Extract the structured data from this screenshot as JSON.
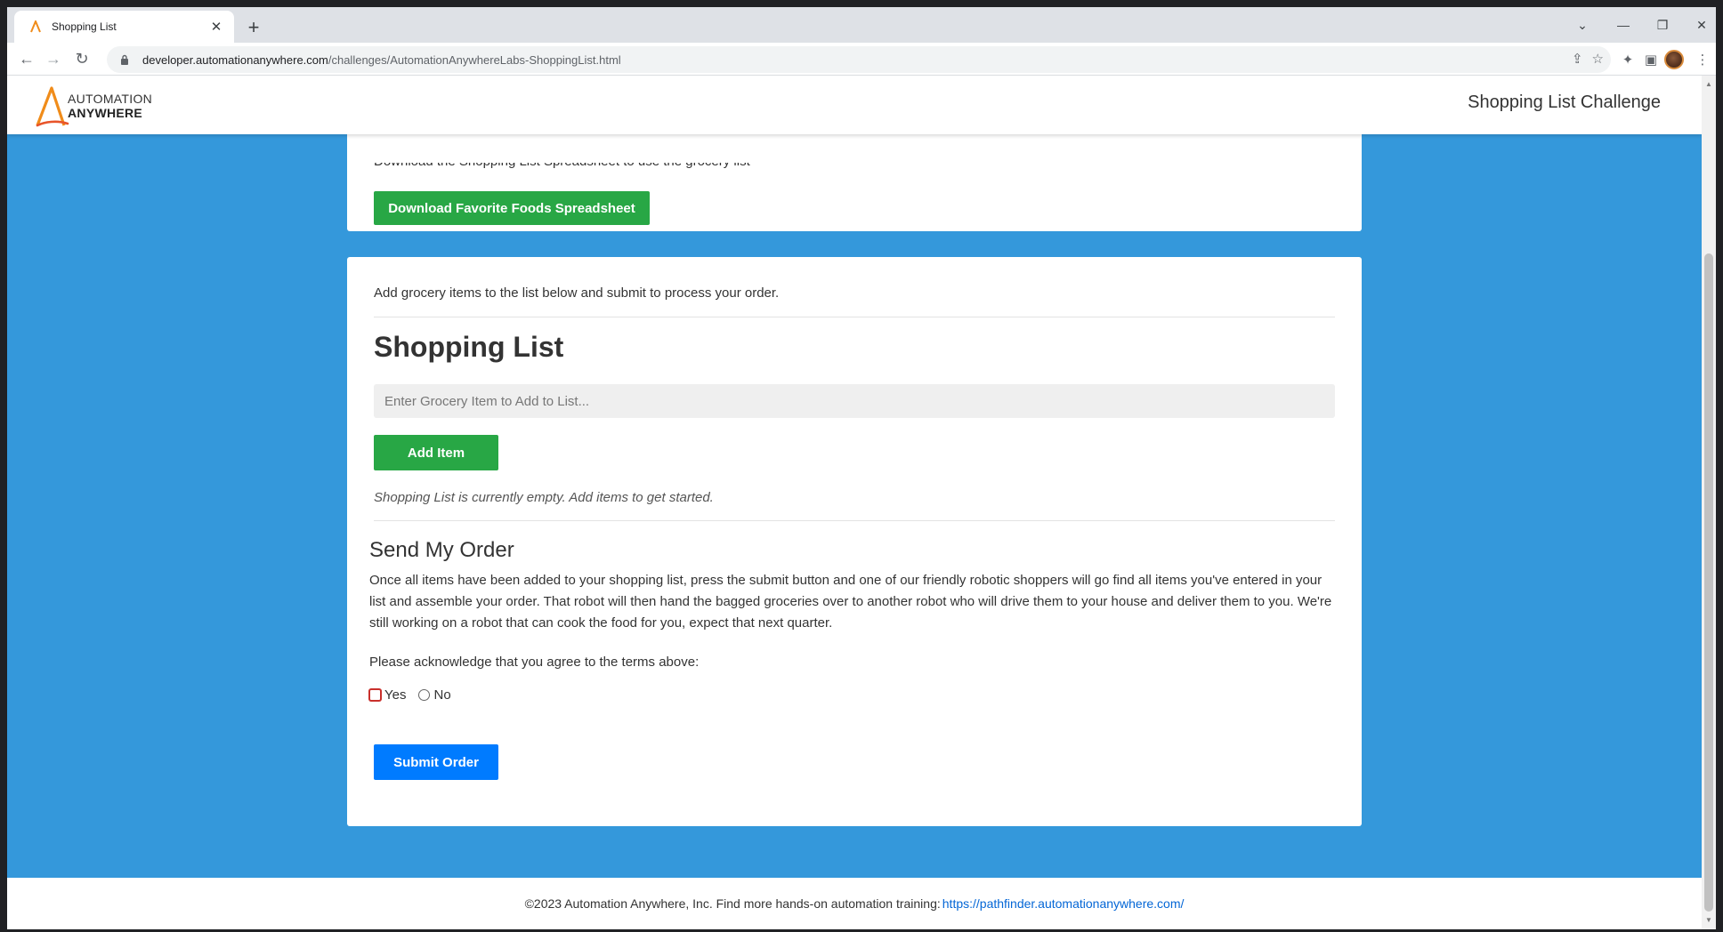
{
  "browser": {
    "tab_title": "Shopping List",
    "url_host": "developer.automationanywhere.com",
    "url_path": "/challenges/AutomationAnywhereLabs-ShoppingList.html",
    "icons": [
      "back-icon",
      "forward-icon",
      "reload-icon",
      "lock-icon",
      "share-icon",
      "star-icon",
      "extensions-icon",
      "side-panel-icon",
      "menu-icon"
    ]
  },
  "header": {
    "logo_line1": "AUTOMATION",
    "logo_line2": "ANYWHERE",
    "title": "Shopping List Challenge",
    "brand_color": "#f08c1a"
  },
  "top_card": {
    "cut_text": "Download the Shopping List Spreadsheet to use the grocery list",
    "download_label": "Download Favorite Foods Spreadsheet"
  },
  "main_card": {
    "intro": "Add grocery items to the list below and submit to process your order.",
    "heading": "Shopping List",
    "input_placeholder": "Enter Grocery Item to Add to List...",
    "add_label": "Add Item",
    "empty_message": "Shopping List is currently empty. Add items to get started.",
    "send_heading": "Send My Order",
    "paragraph": "Once all items have been added to your shopping list, press the submit button and one of our friendly robotic shoppers will go find all items you've entered in your list and assemble your order. That robot will then hand the bagged groceries over to another robot who will drive them to your house and deliver them to you. We're still working on a robot that can cook the food for you, expect that next quarter.",
    "acknowledge": "Please acknowledge that you agree to the terms above:",
    "yes_label": "Yes",
    "no_label": "No",
    "submit_label": "Submit Order"
  },
  "footer": {
    "text": "©2023 Automation Anywhere, Inc. Find more hands-on automation training:",
    "link": "https://pathfinder.automationanywhere.com/"
  },
  "colors": {
    "page_bg": "#3498db",
    "green": "#28a745",
    "blue": "#007bff"
  }
}
